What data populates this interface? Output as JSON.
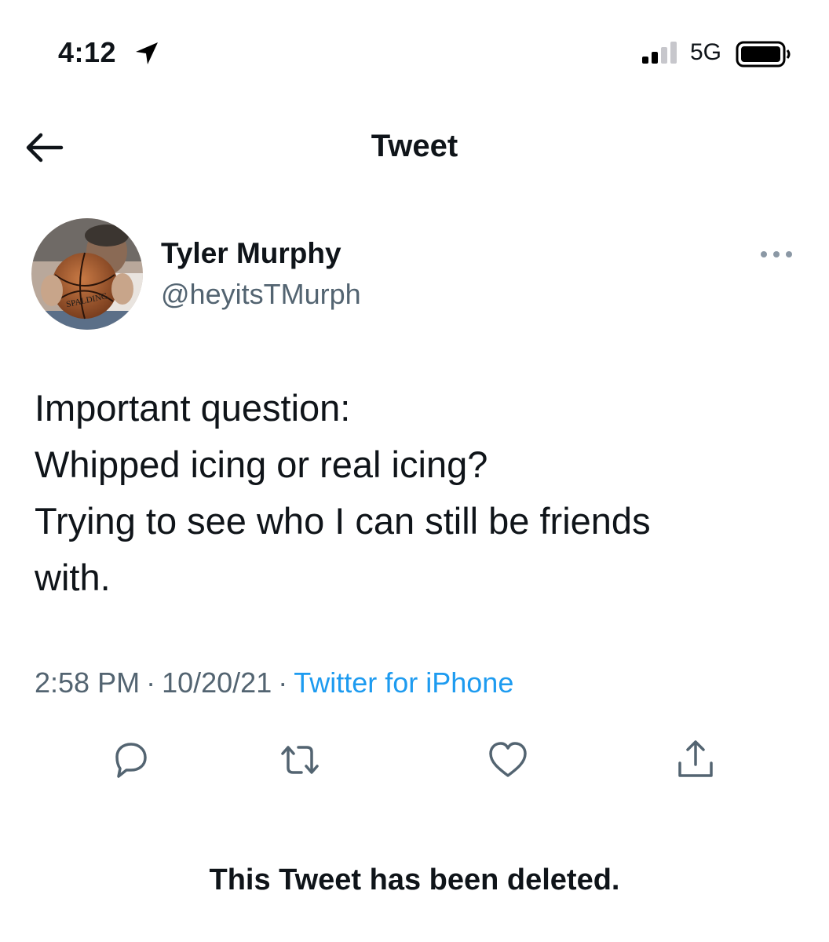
{
  "status_bar": {
    "time": "4:12",
    "network": "5G",
    "signal_bars_filled": 2,
    "signal_bars_total": 4
  },
  "nav": {
    "title": "Tweet"
  },
  "tweet": {
    "author": {
      "display_name": "Tyler Murphy",
      "handle": "@heyitsTMurph",
      "avatar_ball_text": "SPALDING"
    },
    "text_lines": [
      "Important question:",
      "Whipped icing or real icing?",
      "Trying to see who I can still be friends",
      "with."
    ],
    "time": "2:58 PM",
    "separator": "·",
    "date": "10/20/21",
    "source": "Twitter for iPhone",
    "deleted_notice": "This Tweet has been deleted."
  },
  "icons": {
    "back": "arrow-left-icon",
    "more": "ellipsis-icon",
    "reply": "reply-bubble-icon",
    "retweet": "retweet-icon",
    "like": "heart-icon",
    "share": "share-upload-icon",
    "location": "location-arrow-icon",
    "signal": "cellular-signal-icon",
    "battery": "battery-icon"
  },
  "colors": {
    "text": "#0f1419",
    "secondary": "#536471",
    "accent": "#1d9bf0",
    "background": "#ffffff"
  }
}
